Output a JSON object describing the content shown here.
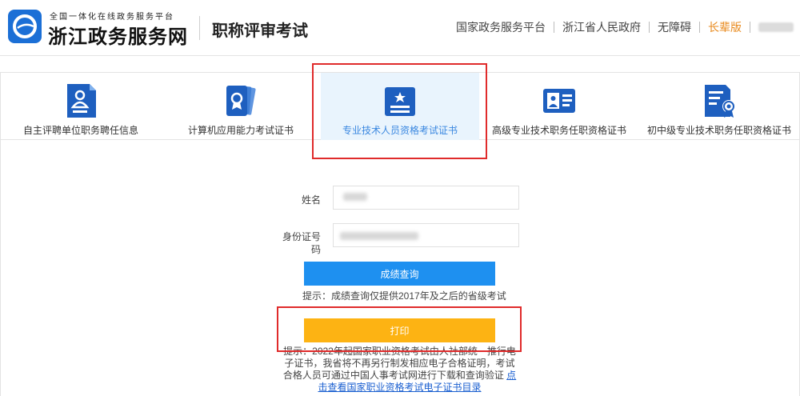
{
  "header": {
    "logo_subtitle": "全国一体化在线政务服务平台",
    "logo_title": "浙江政务服务网",
    "site_title": "职称评审考试",
    "nav": [
      {
        "label": "国家政务服务平台"
      },
      {
        "label": "浙江省人民政府"
      },
      {
        "label": "无障碍"
      },
      {
        "label": "长辈版"
      }
    ],
    "colors": {
      "brand": "#1b6fd6",
      "elder_mode": "#e8891c"
    }
  },
  "tabs": [
    {
      "label": "自主评聘单位职务聘任信息",
      "icon": "document-person-icon",
      "active": false
    },
    {
      "label": "计算机应用能力考试证书",
      "icon": "award-certificate-icon",
      "active": false
    },
    {
      "label": "专业技术人员资格考试证书",
      "icon": "star-certificate-icon",
      "active": true
    },
    {
      "label": "高级专业技术职务任职资格证书",
      "icon": "id-card-icon",
      "active": false
    },
    {
      "label": "初中级专业技术职务任职资格证书",
      "icon": "document-badge-icon",
      "active": false
    }
  ],
  "form": {
    "name_label": "姓名",
    "id_label_line1": "身份证号",
    "id_label_line2": "码",
    "query_button": "成绩查询",
    "query_tip": "提示：成绩查询仅提供2017年及之后的省级考试",
    "print_button": "打印",
    "print_tip": "提示：2022年起国家职业资格考试由人社部统一推行电子证书，我省将不再另行制发相应电子合格证明，考试合格人员可通过中国人事考试网进行下载和查询验证",
    "print_tip_link": "点击查看国家职业资格考试电子证书目录"
  },
  "colors": {
    "primary_button": "#1e90f0",
    "print_button": "#fdb313",
    "active_tab_bg": "#e9f4fd",
    "active_tab_text": "#3a87e0",
    "highlight": "#e02b2b"
  }
}
